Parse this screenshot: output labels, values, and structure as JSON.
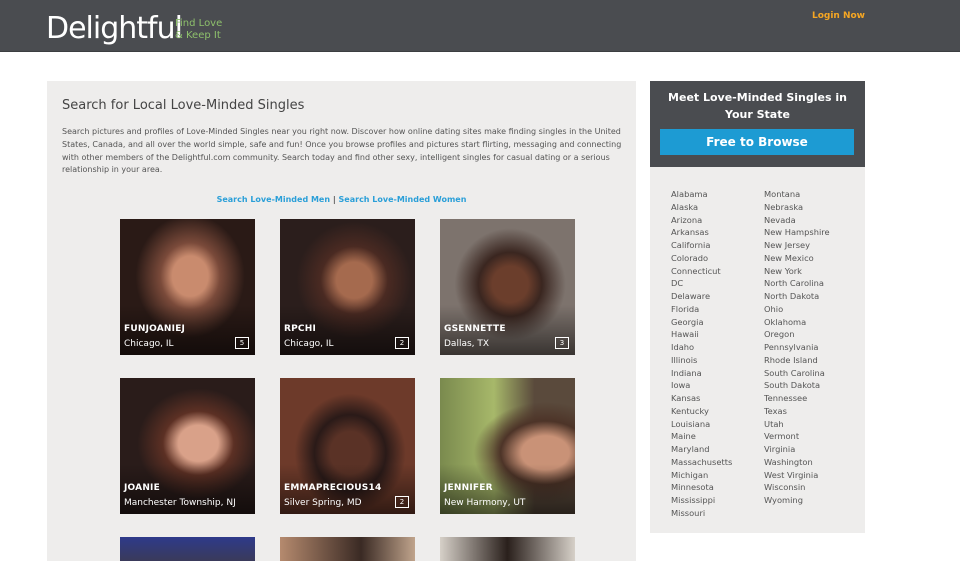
{
  "header": {
    "logo": "Delightful",
    "tagline_line1": "Find Love",
    "tagline_line2": "& Keep It",
    "login": "Login Now",
    "colors": {
      "bar": "#4a4c50",
      "tagline": "#8ec06c",
      "login": "#f5a623"
    }
  },
  "main": {
    "title": "Search for Local Love-Minded Singles",
    "intro": "Search pictures and profiles of Love-Minded Singles near you right now. Discover how online dating sites make finding singles in the United States, Canada, and all over the world simple, safe and fun! Once you browse profiles and pictures start flirting, messaging and connecting with other members of the Delightful.com community. Search today and find other sexy, intelligent singles for casual dating or a serious relationship in your area.",
    "link_men": "Search Love-Minded Men",
    "link_separator": " | ",
    "link_women": "Search Love-Minded Women",
    "profiles": [
      {
        "username": "FUNJOANIEJ",
        "location": "Chicago, IL",
        "photos": "5"
      },
      {
        "username": "RPCHI",
        "location": "Chicago, IL",
        "photos": "2"
      },
      {
        "username": "GSENNETTE",
        "location": "Dallas, TX",
        "photos": "3"
      },
      {
        "username": "JOANIE",
        "location": "Manchester Township, NJ",
        "photos": ""
      },
      {
        "username": "EMMAPRECIOUS14",
        "location": "Silver Spring, MD",
        "photos": "2"
      },
      {
        "username": "JENNIFER",
        "location": "New Harmony, UT",
        "photos": ""
      }
    ]
  },
  "sidebar": {
    "title": "Meet Love-Minded Singles in Your State",
    "button": "Free to Browse",
    "button_color": "#1d9bd3",
    "states_col1": [
      "Alabama",
      "Alaska",
      "Arizona",
      "Arkansas",
      "California",
      "Colorado",
      "Connecticut",
      "DC",
      "Delaware",
      "Florida",
      "Georgia",
      "Hawaii",
      "Idaho",
      "Illinois",
      "Indiana",
      "Iowa",
      "Kansas",
      "Kentucky",
      "Louisiana",
      "Maine",
      "Maryland",
      "Massachusetts",
      "Michigan",
      "Minnesota",
      "Mississippi",
      "Missouri"
    ],
    "states_col2": [
      "Montana",
      "Nebraska",
      "Nevada",
      "New Hampshire",
      "New Jersey",
      "New Mexico",
      "New York",
      "North Carolina",
      "North Dakota",
      "Ohio",
      "Oklahoma",
      "Oregon",
      "Pennsylvania",
      "Rhode Island",
      "South Carolina",
      "South Dakota",
      "Tennessee",
      "Texas",
      "Utah",
      "Vermont",
      "Virginia",
      "Washington",
      "West Virginia",
      "Wisconsin",
      "Wyoming"
    ]
  }
}
